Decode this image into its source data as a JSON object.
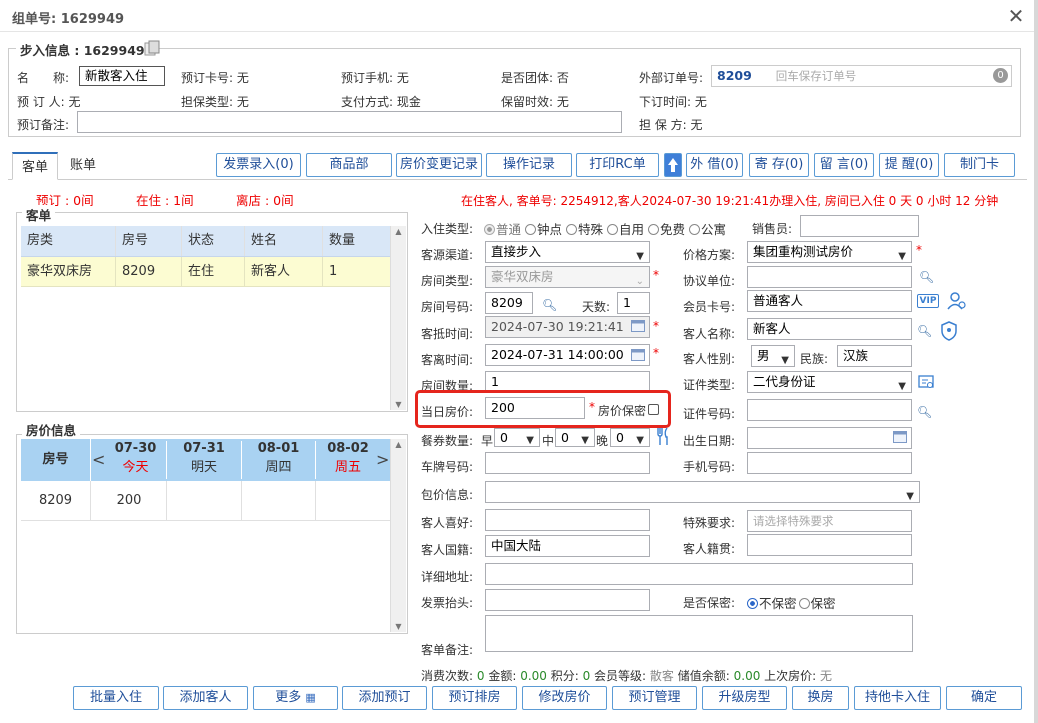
{
  "window": {
    "title": "组单号: 1629949",
    "close": "✕"
  },
  "checkin": {
    "legend": "步入信息 : 1629949",
    "name_label": "名　　称:",
    "name_value": "新散客入住",
    "card_label": "预订卡号: 无",
    "phone_label": "预订手机: 无",
    "group_label": "是否团体: 否",
    "ext_label": "外部订单号:",
    "ext_value": "8209",
    "ext_placeholder": "回车保存订单号",
    "ext_badge": "0",
    "booker_label": "预 订 人: 无",
    "guarantee_type": "担保类型: 无",
    "pay_label": "支付方式: 现金",
    "hold_label": "保留时效: 无",
    "order_time": "下订时间: 无",
    "remark_label": "预订备注:",
    "guarantor": "担 保 方: 无"
  },
  "tabs": {
    "t1": "客单",
    "t2": "账单"
  },
  "toolbar": {
    "b1": "发票录入(0)",
    "b2": "商品部",
    "b3": "房价变更记录",
    "b4": "操作记录",
    "b5": "打印RC单",
    "b6": "外 借(0)",
    "b7": "寄 存(0)",
    "b8": "留 言(0)",
    "b9": "提 醒(0)",
    "b10": "制门卡"
  },
  "stats": {
    "reserve": "预订 : 0间",
    "in": "在住 : 1间",
    "out": "离店 : 0间"
  },
  "status_line": "在住客人, 客单号: 2254912,客人2024-07-30 19:21:41办理入住, 房间已入住 0 天 0 小时 12 分钟",
  "guest_list": {
    "legend": "客单",
    "headers": [
      "房类",
      "房号",
      "状态",
      "姓名",
      "数量"
    ],
    "row": [
      "豪华双床房",
      "8209",
      "在住",
      "新客人",
      "1"
    ]
  },
  "price_info": {
    "legend": "房价信息",
    "col_room": "房号",
    "days": [
      {
        "date": "07-30",
        "week": "今天"
      },
      {
        "date": "07-31",
        "week": "明天"
      },
      {
        "date": "08-01",
        "week": "周四"
      },
      {
        "date": "08-02",
        "week": "周五"
      }
    ],
    "row": {
      "room": "8209",
      "price": "200"
    },
    "prev": "<",
    "next": ">"
  },
  "form": {
    "checkin_type_label": "入住类型:",
    "checkin_types": [
      "普通",
      "钟点",
      "特殊",
      "自用",
      "免费",
      "公寓"
    ],
    "sales_label": "销售员:",
    "channel_label": "客源渠道:",
    "channel_value": "直接步入",
    "price_plan_label": "价格方案:",
    "price_plan_value": "集团重构测试房价",
    "room_type_label": "房间类型:",
    "room_type_value": "豪华双床房",
    "agreement_label": "协议单位:",
    "room_no_label": "房间号码:",
    "room_no_value": "8209",
    "days_label": "天数:",
    "days_value": "1",
    "member_label": "会员卡号:",
    "member_value": "普通客人",
    "vip": "VIP",
    "arrive_label": "客抵时间:",
    "arrive_value": "2024-07-30 19:21:41",
    "guest_name_label": "客人名称:",
    "guest_name_value": "新客人",
    "depart_label": "客离时间:",
    "depart_value": "2024-07-31 14:00:00",
    "gender_label": "客人性别:",
    "gender_value": "男",
    "ethnic_label": "民族:",
    "ethnic_value": "汉族",
    "room_count_label": "房间数量:",
    "room_count_value": "1",
    "id_type_label": "证件类型:",
    "id_type_value": "二代身份证",
    "rate_label": "当日房价:",
    "rate_value": "200",
    "rate_secret_label": "房价保密",
    "id_no_label": "证件号码:",
    "meal_label": "餐券数量:",
    "meal_b": "早",
    "meal_l": "中",
    "meal_d": "晚",
    "meal_b_v": "0",
    "meal_l_v": "0",
    "meal_d_v": "0",
    "birth_label": "出生日期:",
    "plate_label": "车牌号码:",
    "mobile_label": "手机号码:",
    "package_label": "包价信息:",
    "pref_label": "客人喜好:",
    "special_label": "特殊要求:",
    "special_placeholder": "请选择特殊要求",
    "nation_label": "客人国籍:",
    "nation_value": "中国大陆",
    "origin_label": "客人籍贯:",
    "address_label": "详细地址:",
    "invoice_label": "发票抬头:",
    "secret_label": "是否保密:",
    "secret_opts": [
      "不保密",
      "保密"
    ],
    "remark_label": "客单备注:"
  },
  "summary": {
    "c1": "消费次数: ",
    "v1": "0",
    "c2": " 金额: ",
    "v2": "0.00",
    "c3": " 积分: ",
    "v3": "0",
    "c4": " 会员等级: ",
    "v4": "散客",
    "c5": " 储值余额: ",
    "v5": "0.00",
    "c6": " 上次房价: ",
    "v6": "无"
  },
  "bottom": {
    "b1": "批量入住",
    "b2": "添加客人",
    "b3": "更多",
    "b4": "添加预订",
    "b5": "预订排房",
    "b6": "修改房价",
    "b7": "预订管理",
    "b8": "升级房型",
    "b9": "换房",
    "b10": "持他卡入住",
    "b11": "确定"
  },
  "colors": {
    "highlight": "#e5251d",
    "accent": "#1f4e99",
    "red": "#e00000"
  }
}
